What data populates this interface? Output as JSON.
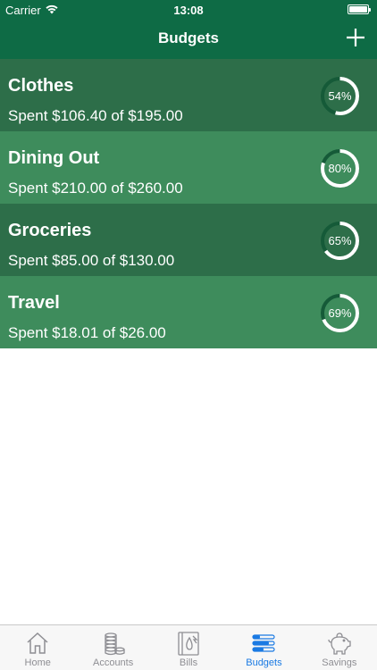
{
  "status": {
    "carrier": "Carrier",
    "time": "13:08"
  },
  "nav": {
    "title": "Budgets"
  },
  "colors": {
    "header": "#0e6b45",
    "row_dark": "#2d6e49",
    "row_light": "#3e8c5c",
    "ring_track": "#155a38",
    "ring_fill": "#ffffff",
    "tab_active": "#1a7ae3",
    "tab_inactive": "#8e8e93"
  },
  "budgets": [
    {
      "name": "Clothes",
      "spent": "Spent $106.40 of $195.00",
      "percent_label": "54%",
      "percent": 54,
      "shade": "dark"
    },
    {
      "name": "Dining Out",
      "spent": "Spent $210.00 of $260.00",
      "percent_label": "80%",
      "percent": 80,
      "shade": "light"
    },
    {
      "name": "Groceries",
      "spent": "Spent $85.00 of $130.00",
      "percent_label": "65%",
      "percent": 65,
      "shade": "dark"
    },
    {
      "name": "Travel",
      "spent": "Spent $18.01 of $26.00",
      "percent_label": "69%",
      "percent": 69,
      "shade": "light"
    }
  ],
  "tabs": [
    {
      "label": "Home",
      "icon": "home-icon",
      "active": false
    },
    {
      "label": "Accounts",
      "icon": "coins-icon",
      "active": false
    },
    {
      "label": "Bills",
      "icon": "bill-icon",
      "active": false
    },
    {
      "label": "Budgets",
      "icon": "sliders-icon",
      "active": true
    },
    {
      "label": "Savings",
      "icon": "piggy-bank-icon",
      "active": false
    }
  ]
}
